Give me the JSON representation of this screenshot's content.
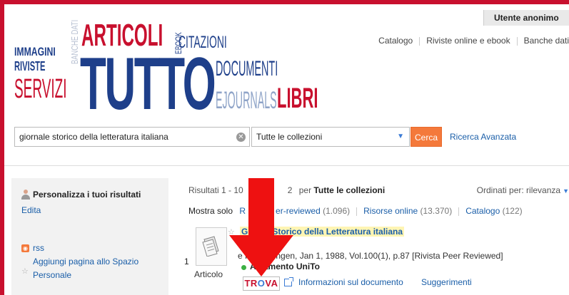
{
  "header": {
    "user_label": "Utente anonimo",
    "nav": [
      "Catalogo",
      "Riviste online e ebook",
      "Banche dati"
    ]
  },
  "logo": {
    "words": [
      "IMMAGINI",
      "BANCHE DATI",
      "ARTICOLI",
      "EBOOK",
      "CITAZIONI",
      "RIVISTE",
      "SERVIZI",
      "TUTTO",
      "DOCUMENTI",
      "EJOURNALS",
      "LIBRI"
    ],
    "colors": {
      "red": "#c8102e",
      "blue": "#1e3f8a",
      "lightblue": "#8fa4c8",
      "gray": "#b9c2d3"
    }
  },
  "search": {
    "query": "giornale storico della letteratura italiana",
    "collection": "Tutte le collezioni",
    "button_label": "Cerca",
    "advanced_label": "Ricerca Avanzata"
  },
  "sidebar": {
    "title": "Personalizza i tuoi risultati",
    "edit_label": "Edita",
    "rss_label": "rss",
    "add_page_label": "Aggiungi pagina allo Spazio Personale"
  },
  "results": {
    "summary_prefix": "Risultati 1 - 10",
    "summary_suffix": "2",
    "per_label": "per",
    "collection": "Tutte le collezioni",
    "sort_label": "Ordinati per:",
    "sort_value": "rilevanza",
    "show_only_label": "Mostra solo",
    "filters": [
      {
        "label": "R",
        "count": ""
      },
      {
        "label": "er-reviewed",
        "count": "(1.096)"
      },
      {
        "label": "Risorse online",
        "count": "(13.370)"
      },
      {
        "label": "Catalogo",
        "count": "(122)"
      }
    ]
  },
  "result": {
    "number": "1",
    "type": "Articolo",
    "title_start": "G",
    "title_visible": "Storico della Letteratura italiana",
    "subtitle_fragment": "e",
    "source": "e Forschungen, Jan 1, 1988, Vol.100(1), p.87 [Rivista Peer Reviewed]",
    "availability": "A   namento UniTo",
    "trova_label": "TROVA",
    "info_label": "Informazioni sul documento",
    "suggestions_label": "Suggerimenti"
  },
  "colors": {
    "accent_red": "#c8102e",
    "link_blue": "#1a5ea8",
    "button_orange": "#f4793b",
    "frame_red": "#c8102e",
    "available_green": "#3cb043"
  }
}
